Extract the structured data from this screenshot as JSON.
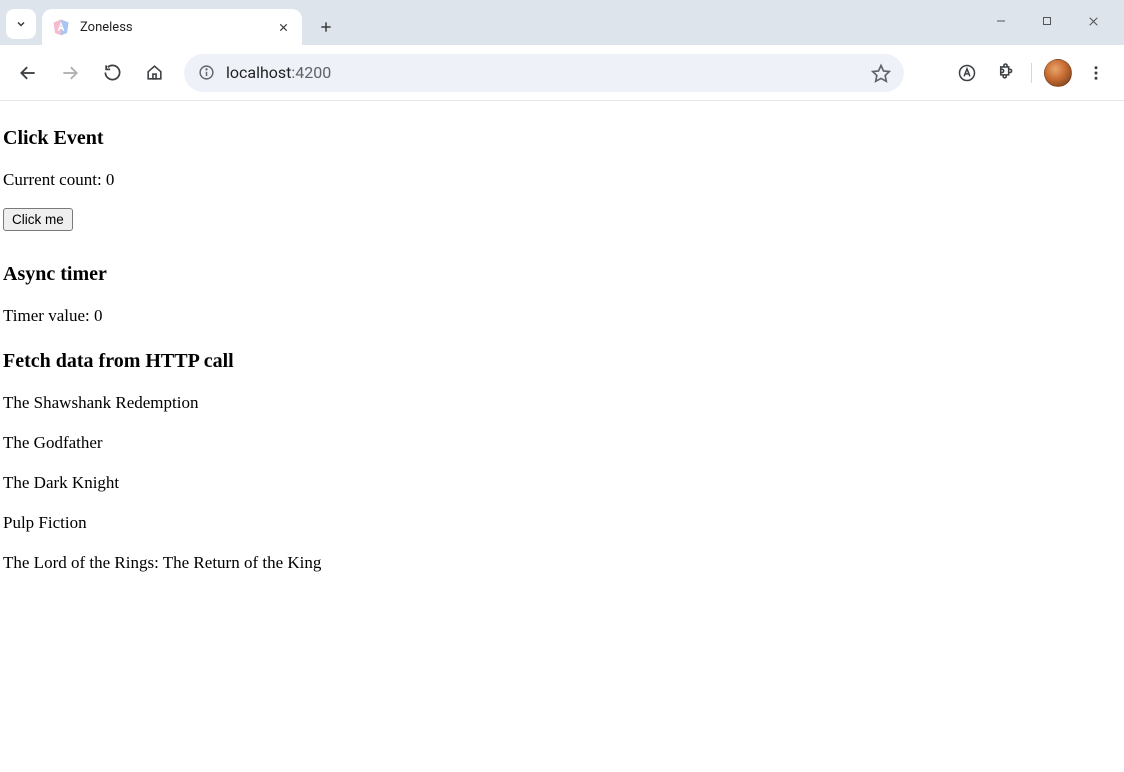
{
  "browser": {
    "tab_title": "Zoneless",
    "url_host": "localhost",
    "url_port": ":4200"
  },
  "content": {
    "section1": {
      "heading": "Click Event",
      "count_prefix": "Current count: ",
      "count_value": "0",
      "button_label": "Click me"
    },
    "section2": {
      "heading": "Async timer",
      "timer_prefix": "Timer value: ",
      "timer_value": "0"
    },
    "section3": {
      "heading": "Fetch data from HTTP call",
      "items": [
        "The Shawshank Redemption",
        "The Godfather",
        "The Dark Knight",
        "Pulp Fiction",
        "The Lord of the Rings: The Return of the King"
      ]
    }
  }
}
